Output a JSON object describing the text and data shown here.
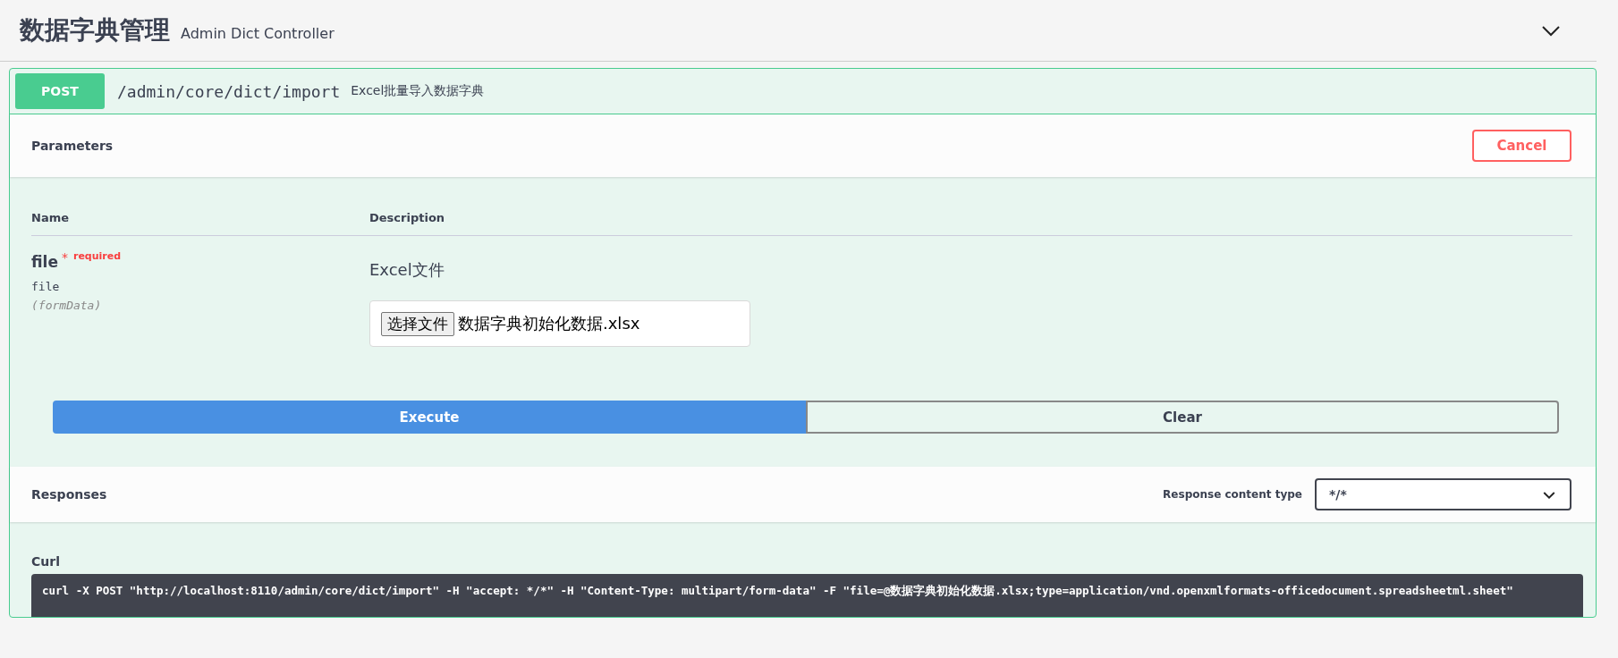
{
  "tag": {
    "title": "数据字典管理",
    "description": "Admin Dict Controller",
    "expanded": true
  },
  "operation": {
    "method": "POST",
    "path": "/admin/core/dict/import",
    "summary": "Excel批量导入数据字典"
  },
  "parameters": {
    "title": "Parameters",
    "cancel_button": "Cancel",
    "columns": [
      "Name",
      "Description"
    ],
    "rows": [
      {
        "name": "file",
        "required_mark": "*",
        "required": true,
        "required_label": "required",
        "type": "file",
        "location": "(formData)",
        "description": "Excel文件",
        "file_button": "选择文件",
        "file_name": "数据字典初始化数据.xlsx"
      }
    ]
  },
  "actions": [
    {
      "label": "Execute",
      "kind": "primary"
    },
    {
      "label": "Clear",
      "kind": "secondary"
    }
  ],
  "responses": {
    "title": "Responses",
    "content_type_label": "Response content type",
    "content_type": "*/*"
  },
  "curl": {
    "label": "Curl",
    "command": "curl -X POST \"http://localhost:8110/admin/core/dict/import\" -H \"accept: */*\" -H \"Content-Type: multipart/form-data\" -F \"file=@数据字典初始化数据.xlsx;type=application/vnd.openxmlformats-officedocument.spreadsheetml.sheet\""
  }
}
